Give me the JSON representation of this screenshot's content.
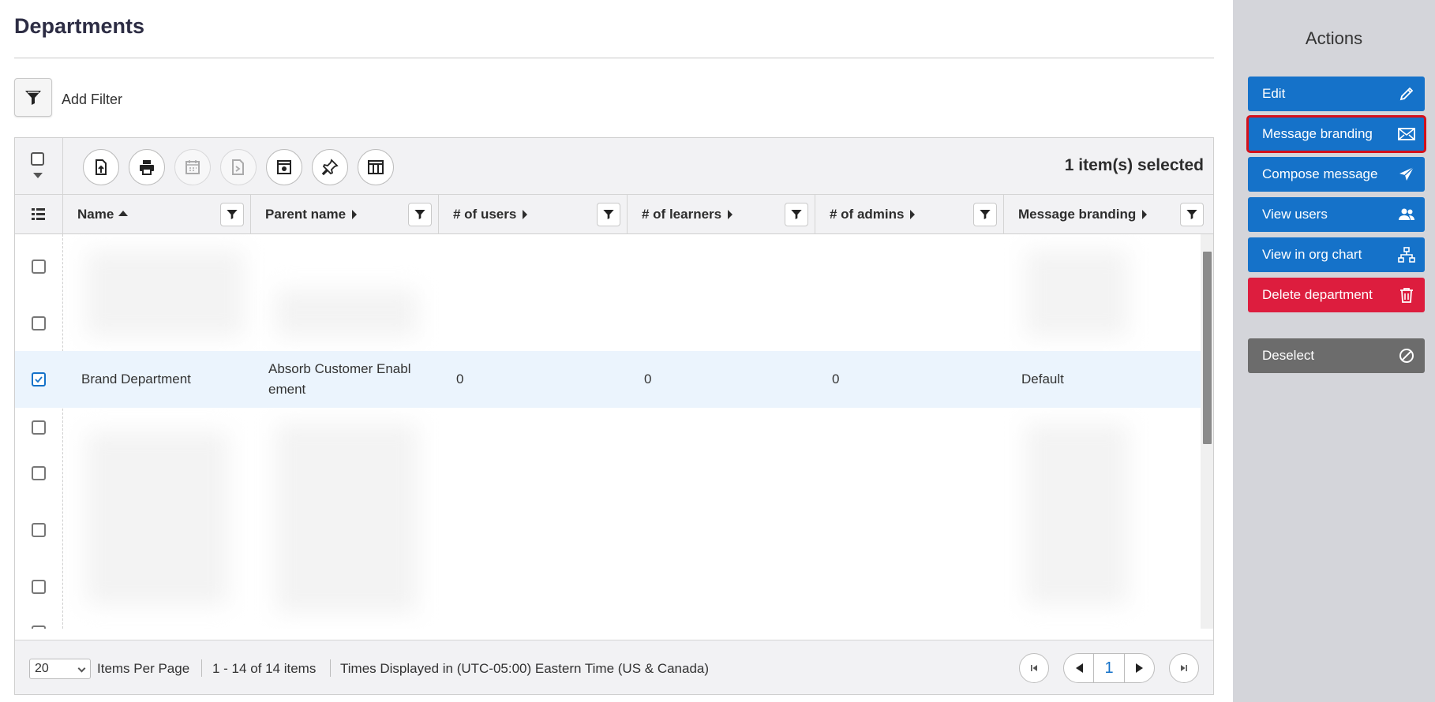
{
  "page": {
    "title": "Departments"
  },
  "filter": {
    "add_filter_label": "Add Filter"
  },
  "toolbar": {
    "selected_count": "1 item(s) selected",
    "icons": [
      "export-icon",
      "print-icon",
      "schedule-icon",
      "report-icon",
      "settings-icon",
      "pin-icon",
      "columns-icon"
    ]
  },
  "columns": [
    {
      "label": "Name",
      "sort": "asc"
    },
    {
      "label": "Parent name",
      "sort": "none"
    },
    {
      "label": "# of users",
      "sort": "none"
    },
    {
      "label": "# of learners",
      "sort": "none"
    },
    {
      "label": "# of admins",
      "sort": "none"
    },
    {
      "label": "Message branding",
      "sort": "none"
    }
  ],
  "selected_row": {
    "name": "Brand Department",
    "parent_name_line1": "Absorb Customer Enabl",
    "parent_name_line2": "ement",
    "users": "0",
    "learners": "0",
    "admins": "0",
    "message_branding": "Default"
  },
  "footer": {
    "per_page": "20",
    "items_per_page_label": "Items Per Page",
    "range": "1 - 14 of 14 items",
    "timezone": "Times Displayed in (UTC-05:00) Eastern Time (US & Canada)",
    "current_page": "1"
  },
  "sidebar": {
    "title": "Actions",
    "actions": [
      {
        "label": "Edit",
        "icon": "pencil-icon"
      },
      {
        "label": "Message branding",
        "icon": "envelope-icon"
      },
      {
        "label": "Compose message",
        "icon": "paper-plane-icon"
      },
      {
        "label": "View users",
        "icon": "users-icon"
      },
      {
        "label": "View in org chart",
        "icon": "org-chart-icon"
      },
      {
        "label": "Delete department",
        "icon": "trash-icon"
      },
      {
        "label": "Deselect",
        "icon": "ban-icon"
      }
    ]
  },
  "colors": {
    "primary": "#1572c9",
    "danger": "#dd1d3e",
    "neutral": "#6c6c6c",
    "highlight_outline": "#d4101b",
    "sidebar_bg": "#d4d5da",
    "selected_row_bg": "#ebf4fd"
  }
}
